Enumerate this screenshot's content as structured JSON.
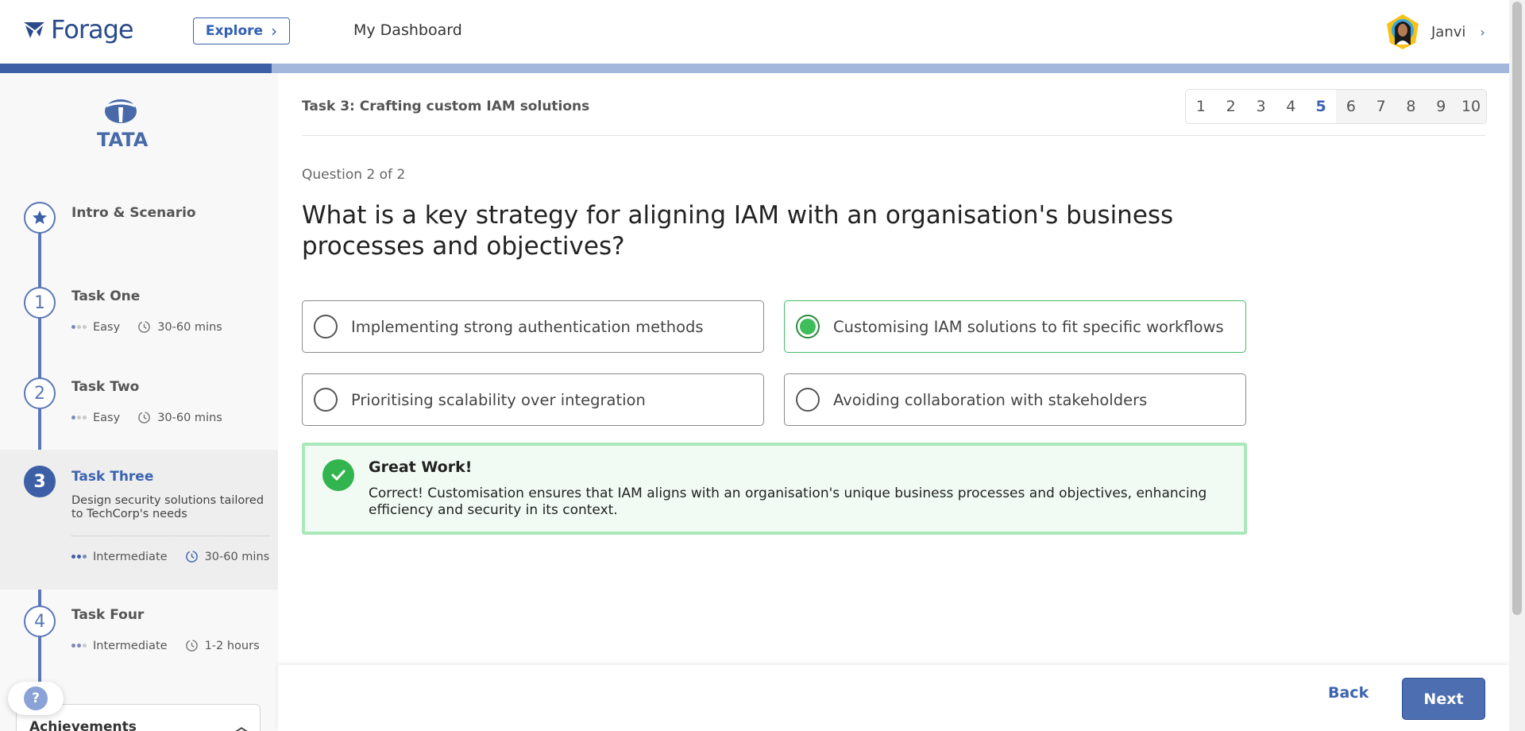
{
  "header": {
    "logo_text": "Forage",
    "explore_label": "Explore",
    "dashboard_label": "My Dashboard",
    "user_name": "Janvi"
  },
  "progress": {
    "fraction": 0.18
  },
  "sidebar": {
    "company_logo_text": "TATA",
    "steps": [
      {
        "number": "",
        "icon": "star-icon",
        "title": "Intro & Scenario"
      },
      {
        "number": "1",
        "title": "Task One",
        "difficulty": "Easy",
        "duration": "30-60 mins"
      },
      {
        "number": "2",
        "title": "Task Two",
        "difficulty": "Easy",
        "duration": "30-60 mins"
      },
      {
        "number": "3",
        "title": "Task Three",
        "description": "Design security solutions tailored to TechCorp's needs",
        "difficulty": "Intermediate",
        "duration": "30-60 mins"
      },
      {
        "number": "4",
        "title": "Task Four",
        "difficulty": "Intermediate",
        "duration": "1-2 hours"
      }
    ],
    "help_label": "?",
    "achievements_label": "Achievements"
  },
  "main": {
    "task_title": "Task 3: Crafting custom IAM solutions",
    "pages": [
      "1",
      "2",
      "3",
      "4",
      "5",
      "6",
      "7",
      "8",
      "9",
      "10"
    ],
    "current_page": "5",
    "question_counter": "Question 2 of 2",
    "question": "What is a key strategy for aligning IAM with an organisation's business processes and objectives?",
    "options": [
      {
        "label": "Implementing strong authentication methods",
        "selected": false
      },
      {
        "label": "Customising IAM solutions to fit specific workflows",
        "selected": true
      },
      {
        "label": "Prioritising scalability over integration",
        "selected": false
      },
      {
        "label": "Avoiding collaboration with stakeholders",
        "selected": false
      }
    ],
    "feedback": {
      "title": "Great Work!",
      "text": "Correct! Customisation ensures that IAM aligns with an organisation's unique business processes and objectives, enhancing efficiency and security in its context."
    }
  },
  "footer": {
    "back_label": "Back",
    "next_label": "Next"
  },
  "colors": {
    "brand": "#3c5fa6",
    "success": "#3ebd5b",
    "accent_link": "#3c63b0"
  }
}
